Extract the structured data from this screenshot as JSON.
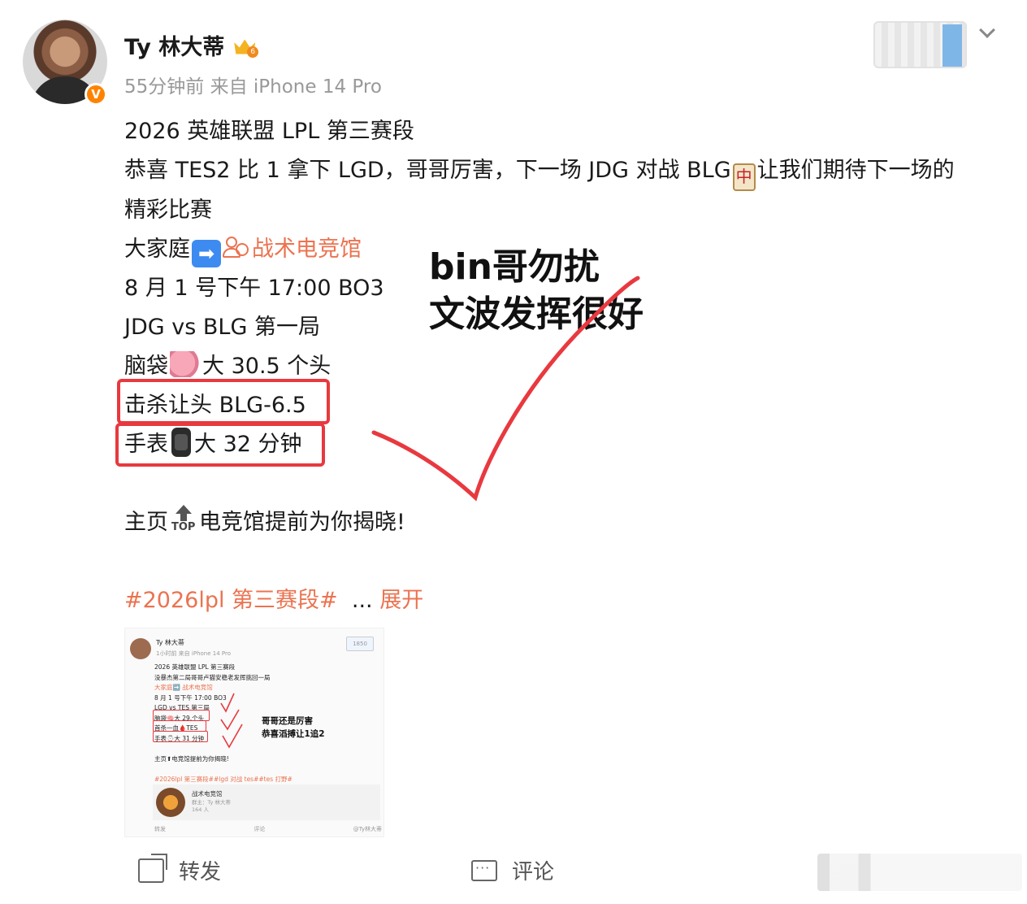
{
  "user": {
    "name": "Ty 林大蒂",
    "level": "6",
    "verified_mark": "V",
    "meta": "55分钟前  来自 iPhone 14 Pro"
  },
  "post": {
    "line1": "2026 英雄联盟 LPL 第三赛段",
    "line2a": "恭喜 TES2 比 1 拿下 LGD，哥哥厉害，下一场 JDG 对战 BLG",
    "mahjong": "中",
    "line2b": "让我们期待下一场的",
    "line3": "精彩比赛",
    "line4a": "大家庭",
    "arrow": "➡",
    "line4link": "战术电竞馆",
    "line5": "8 月 1 号下午 17:00 BO3",
    "line6": "JDG vs BLG 第一局",
    "line7a": "脑袋",
    "line7b": "大 30.5 个头",
    "line8": "击杀让头 BLG-6.5",
    "line9a": "手表",
    "line9b": "大 32 分钟",
    "line10a": "主页",
    "top_label": "TOP",
    "line10b": "电竞馆提前为你揭晓!",
    "hashtag": "#2026lpl 第三赛段#",
    "ellipsis": "...",
    "expand": "展开"
  },
  "overlay": {
    "line1": "bin哥勿扰",
    "line2": "文波发挥很好"
  },
  "thumbnail": {
    "name": "Ty 林大蒂",
    "meta": "1小时前  来自 iPhone 14 Pro",
    "follow": "1850",
    "lines": [
      "2026 英雄联盟 LPL 第三赛段",
      "没暴杰第二局哥哥卢猫安稳老发挥挑回一局",
      "大家庭➡️ 战术电竞馆",
      "8 月 1 号下午 17:00 BO3",
      "LGD vs TES 第三局",
      "脑袋🧠大 29.个头",
      "首杀一血🩸TES",
      "手表⌚大 31 分钟",
      "",
      "主页⬆电竞馆提前为你揭晓!",
      "",
      "#2026lpl 第三赛段##lgd 对战 tes##tes 打野#"
    ],
    "overlay1": "哥哥还是厉害",
    "overlay2": "恭喜滔搏让1追2",
    "card_name": "战术电竞馆",
    "card_sub1": "群主：Ty 林大蒂",
    "card_sub2": "164 人",
    "foot_share": "转发",
    "foot_comment": "评论",
    "foot_mark": "@Ty林大蒂"
  },
  "actions": {
    "share": "转发",
    "comment": "评论"
  },
  "colors": {
    "link": "#eb7350",
    "box": "#e8393f",
    "verified": "#ff8200"
  }
}
